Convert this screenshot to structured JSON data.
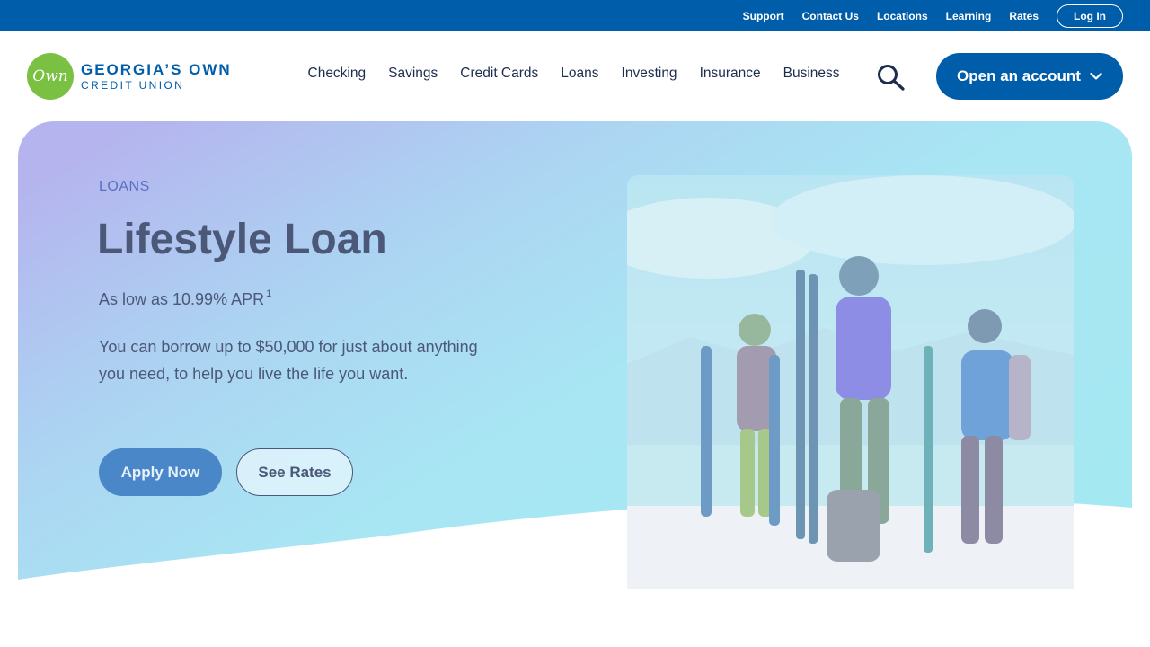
{
  "utility": {
    "links": [
      "Support",
      "Contact Us",
      "Locations",
      "Learning",
      "Rates"
    ],
    "login_label": "Log In"
  },
  "brand": {
    "mark_text": "Own",
    "name_line1": "GEORGIA’S OWN",
    "name_line2": "CREDIT UNION"
  },
  "nav": {
    "items": [
      "Checking",
      "Savings",
      "Credit Cards",
      "Loans",
      "Investing",
      "Insurance",
      "Business"
    ],
    "search_icon": "search-icon",
    "open_account_label": "Open an account"
  },
  "hero": {
    "eyebrow": "LOANS",
    "title": "Lifestyle Loan",
    "rate_text": "As low as 10.99% APR",
    "rate_footnote": "1",
    "description": "You can borrow up to $50,000 for just about anything you need, to help you live the life you want.",
    "apply_label": "Apply Now",
    "rates_label": "See Rates"
  },
  "colors": {
    "primary": "#005da9",
    "nav_text": "#1d2d4e",
    "hero_text": "#4b5878",
    "eyebrow": "#5a6fc4",
    "logo_green": "#7ac143"
  }
}
